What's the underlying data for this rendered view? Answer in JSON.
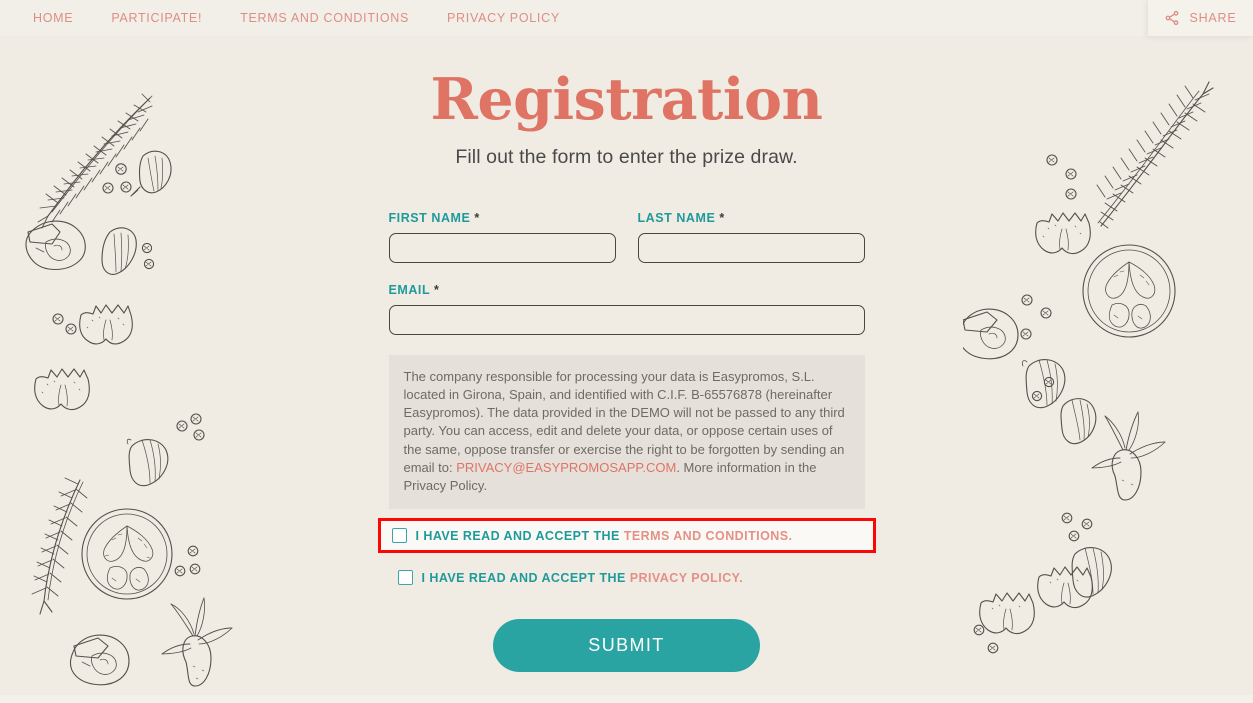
{
  "nav": {
    "links": [
      {
        "label": "HOME"
      },
      {
        "label": "PARTICIPATE!"
      },
      {
        "label": "TERMS AND CONDITIONS"
      },
      {
        "label": "PRIVACY POLICY"
      }
    ],
    "share": {
      "label": "SHARE",
      "icon": "share-nodes-icon"
    }
  },
  "header": {
    "title": "Registration",
    "subtitle": "Fill out the form to enter the prize draw."
  },
  "form": {
    "first_name": {
      "label": "FIRST NAME",
      "required_mark": "*",
      "value": "",
      "placeholder": ""
    },
    "last_name": {
      "label": "LAST NAME",
      "required_mark": "*",
      "value": "",
      "placeholder": ""
    },
    "email": {
      "label": "EMAIL",
      "required_mark": "*",
      "value": "",
      "placeholder": ""
    },
    "legal_notice": {
      "part1": "The company responsible for processing your data is Easypromos, S.L. located in Girona, Spain, and identified with C.I.F. B-65576878 (hereinafter Easypromos). The data provided in the DEMO will not be passed to any third party. You can access, edit and delete your data, or oppose certain uses of the same, oppose transfer or exercise the right to be forgotten by sending an email to: ",
      "email_link": "PRIVACY@EASYPROMOSAPP.COM",
      "part2": ". More information in the Privacy Policy."
    },
    "consents": [
      {
        "prefix": "I HAVE READ AND ACCEPT THE ",
        "link": "TERMS AND CONDITIONS",
        "suffix": ".",
        "checked": false,
        "highlighted": true
      },
      {
        "prefix": "I HAVE READ AND ACCEPT THE ",
        "link": "PRIVACY POLICY",
        "suffix": ".",
        "checked": false,
        "highlighted": false
      }
    ],
    "submit_label": "SUBMIT"
  },
  "theme": {
    "background": "#f0ece4",
    "accent_coral": "#df7464",
    "accent_teal": "#2aa3a3",
    "highlight_red": "#fb0707",
    "legal_box_bg": "#e5e1da",
    "input_border": "#4b4540",
    "sketch_ink": "#4a4640"
  },
  "decoration": {
    "style": "hand-drawn-ink-food-sketches",
    "items": [
      "rosemary-sprig",
      "garlic-clove",
      "peppercorns",
      "mushroom",
      "farfalle-pasta",
      "tomato-slice",
      "olive-with-leaves"
    ]
  }
}
